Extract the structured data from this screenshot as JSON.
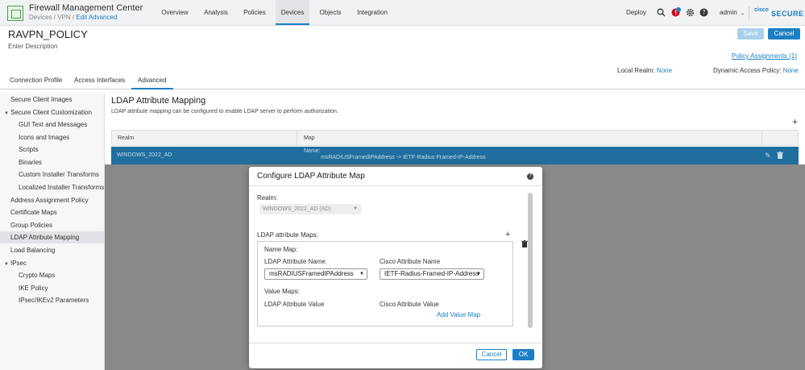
{
  "app": {
    "title": "Firewall Management Center",
    "breadcrumb_prefix": "Devices / VPN / ",
    "breadcrumb_current": "Edit Advanced"
  },
  "topnav": {
    "tabs": [
      "Overview",
      "Analysis",
      "Policies",
      "Devices",
      "Objects",
      "Integration"
    ],
    "active_tab": "Devices",
    "deploy_label": "Deploy",
    "user_label": "admin",
    "brand_cisco": "cisco",
    "brand_secure": "SECURE"
  },
  "policy": {
    "name": "RAVPN_POLICY",
    "description": "Enter Description",
    "save_label": "Save",
    "cancel_label": "Cancel",
    "assignments_label": "Policy Assignments (1)",
    "local_realm_label": "Local Realm:",
    "local_realm_value": "None",
    "dap_label": "Dynamic Access Policy:",
    "dap_value": "None"
  },
  "subtabs": [
    "Connection Profile",
    "Access Interfaces",
    "Advanced"
  ],
  "sidebar": {
    "items": [
      {
        "label": "Secure Client Images"
      },
      {
        "label": "Secure Client Customization"
      },
      {
        "label": "GUI Text and Messages"
      },
      {
        "label": "Icons and Images"
      },
      {
        "label": "Scripts"
      },
      {
        "label": "Binaries"
      },
      {
        "label": "Custom Installer Transforms"
      },
      {
        "label": "Localized Installer Transforms"
      },
      {
        "label": "Address Assignment Policy"
      },
      {
        "label": "Certificate Maps"
      },
      {
        "label": "Group Policies"
      },
      {
        "label": "LDAP Attribute Mapping"
      },
      {
        "label": "Load Balancing"
      },
      {
        "label": "IPsec"
      },
      {
        "label": "Crypto Maps"
      },
      {
        "label": "IKE Policy"
      },
      {
        "label": "IPsec/IKEv2 Parameters"
      }
    ]
  },
  "main": {
    "title": "LDAP Attribute Mapping",
    "description": "LDAP attribute mapping can be configured to enable LDAP server to perform authorization.",
    "table": {
      "columns": [
        "Realm",
        "Map"
      ],
      "rows": [
        {
          "realm": "WINDOWS_2022_AD",
          "map_label": "Name:",
          "map_value": "msRADIUSFramedIPAddress -> IETF-Radius-Framed-IP-Address"
        }
      ]
    }
  },
  "modal": {
    "title": "Configure LDAP Attribute Map",
    "realm_label": "Realm:",
    "realm_value": "WINDOWS_2022_AD (AD)",
    "maps_label": "LDAP attribute Maps:",
    "name_map_label": "Name Map:",
    "ldap_attr_name_label": "LDAP Attribute Name",
    "cisco_attr_name_label": "Cisco Attribute Name",
    "ldap_attr_name_value": "msRADIUSFramedIPAddress",
    "cisco_attr_name_value": "IETF-Radius-Framed-IP-Address",
    "value_maps_label": "Value Maps:",
    "ldap_attr_value_label": "LDAP Attribute Value",
    "cisco_attr_value_label": "Cisco Attribute Value",
    "add_value_map_label": "Add Value Map",
    "cancel_label": "Cancel",
    "ok_label": "OK"
  },
  "colors": {
    "accent": "#1c7fc4",
    "selected_row": "#1f6e9e",
    "logo_green": "#49a14a"
  },
  "icons": [
    "search-icon",
    "alert-icon",
    "gear-icon",
    "help-icon",
    "chevron-down-icon",
    "plus-icon",
    "edit-icon",
    "trash-icon",
    "caret-down-icon"
  ]
}
